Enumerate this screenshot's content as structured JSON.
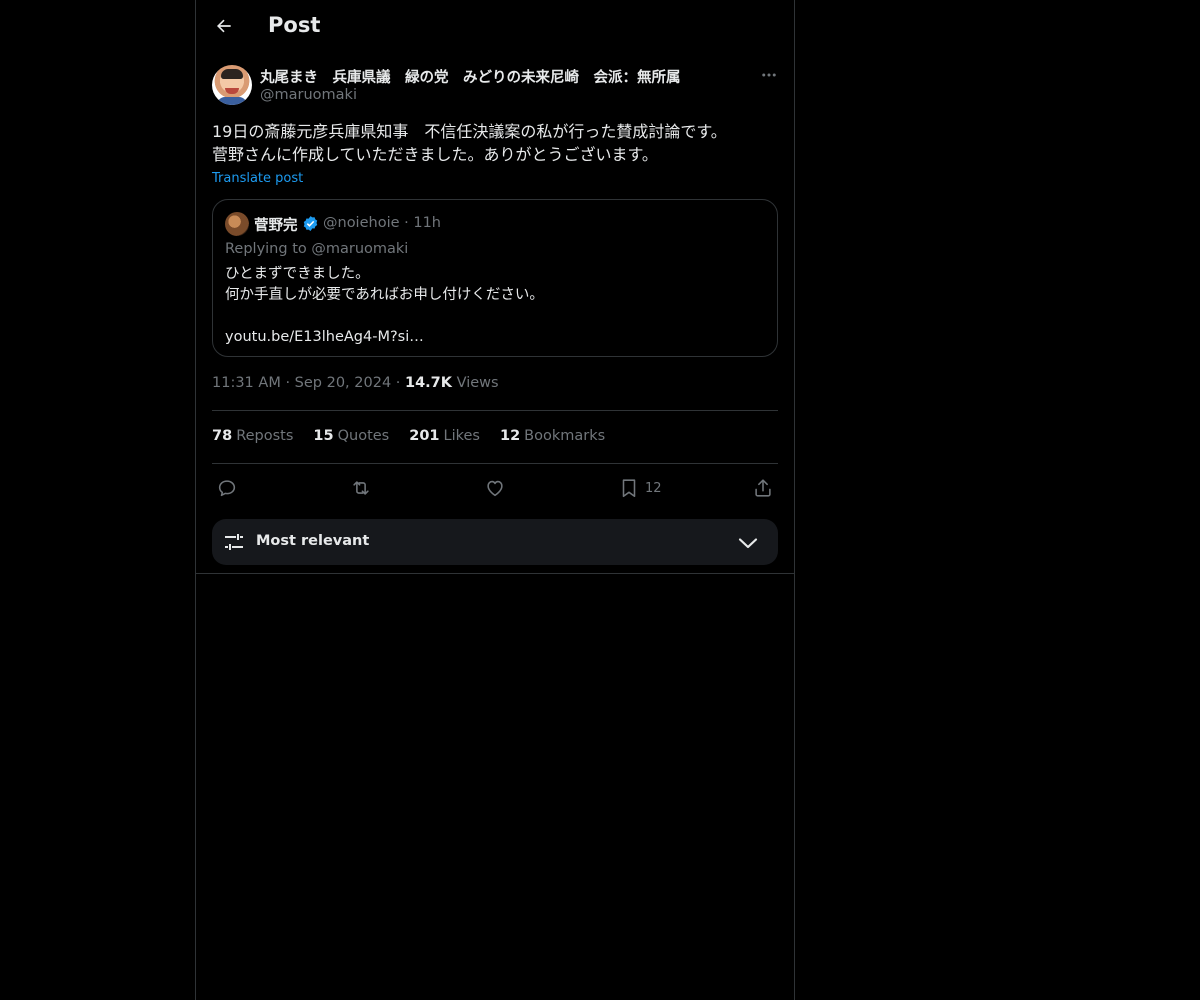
{
  "header": {
    "title": "Post",
    "back_icon": "arrow-left-icon"
  },
  "post": {
    "author_name": "丸尾まき　兵庫県議　緑の党　みどりの未来尼崎　会派：無所属",
    "author_handle": "@maruomaki",
    "text_lines": [
      "19日の斎藤元彦兵庫県知事　不信任決議案の私が行った賛成討論です。",
      "菅野さんに作成していただきました。ありがとうございます。"
    ],
    "translate_label": "Translate post",
    "time": "11:31 AM",
    "date": "Sep 20, 2024",
    "views_count": "14.7K",
    "views_label": "Views"
  },
  "quote": {
    "name": "菅野完",
    "handle": "@noiehoie",
    "age": "11h",
    "replying_to": "Replying to @maruomaki",
    "body_lines": [
      "ひとまずできました。",
      "何か手直しが必要であればお申し付けください。",
      "",
      "youtu.be/E13lheAg4-M?si…"
    ]
  },
  "stats": [
    {
      "count": "78",
      "label": "Reposts"
    },
    {
      "count": "15",
      "label": "Quotes"
    },
    {
      "count": "201",
      "label": "Likes"
    },
    {
      "count": "12",
      "label": "Bookmarks"
    }
  ],
  "actions": {
    "reply_icon": "reply-icon",
    "repost_icon": "repost-icon",
    "like_icon": "heart-icon",
    "bookmark_icon": "bookmark-icon",
    "bookmark_count": "12",
    "share_icon": "share-icon"
  },
  "sort": {
    "label": "Most relevant"
  },
  "colors": {
    "background": "#000000",
    "text": "#e7e9ea",
    "muted": "#71767b",
    "link": "#1d9bf0",
    "border": "#2f3336",
    "verified": "#1d9bf0"
  }
}
